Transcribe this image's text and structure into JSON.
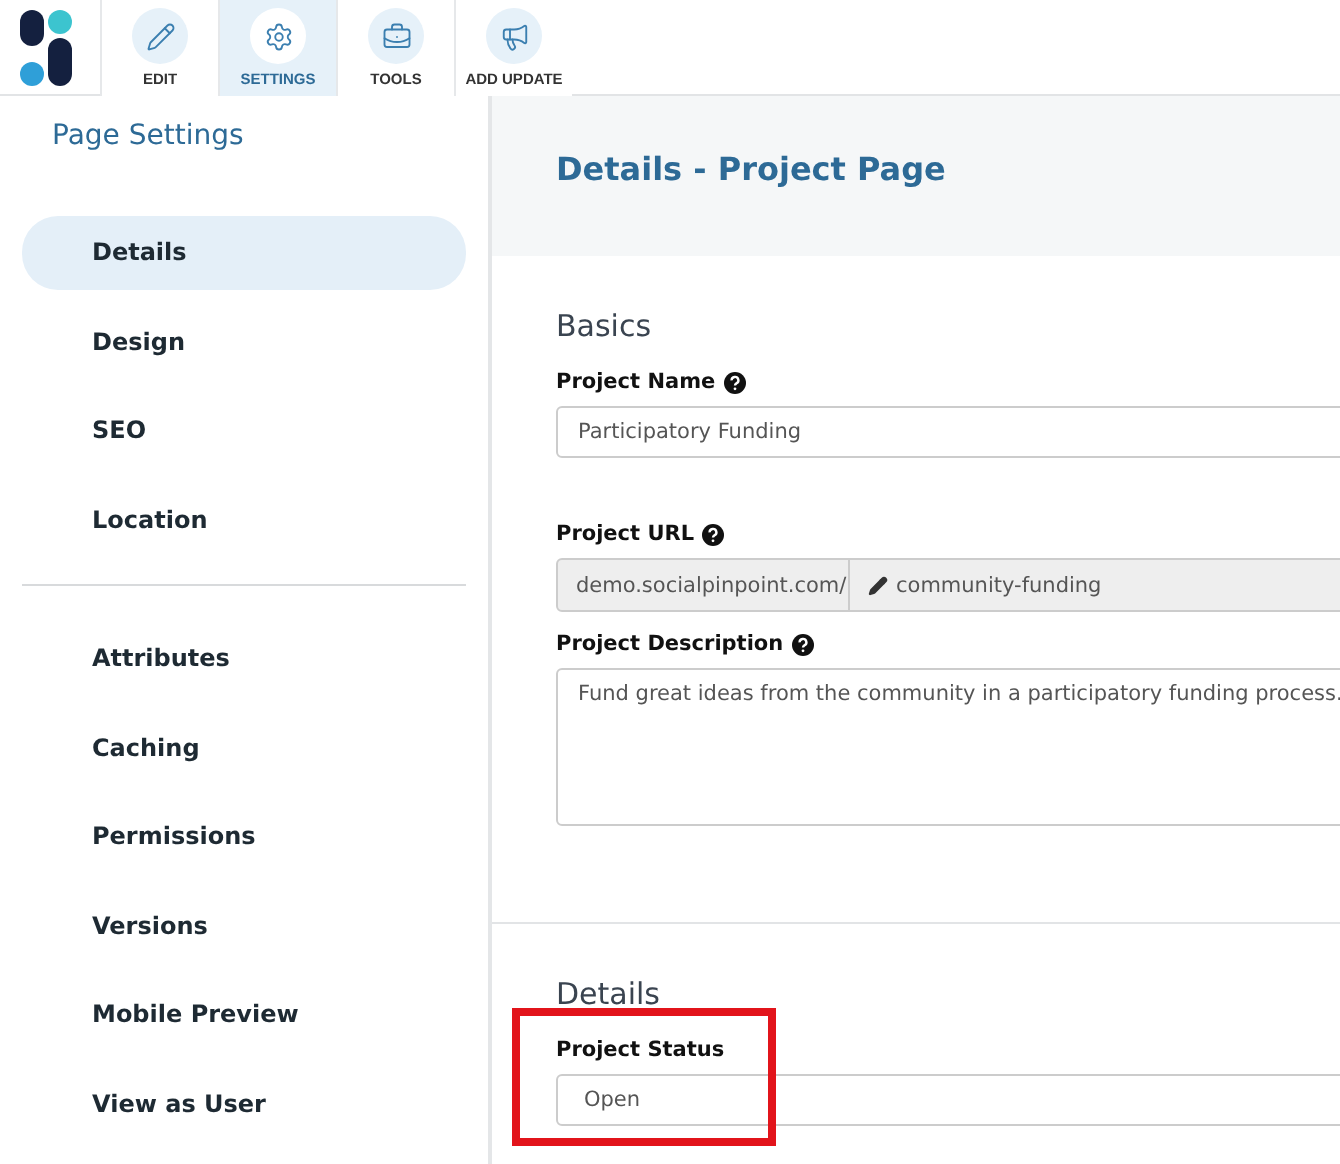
{
  "toolbar": {
    "tabs": [
      {
        "label": "EDIT",
        "selected": false
      },
      {
        "label": "SETTINGS",
        "selected": true
      },
      {
        "label": "TOOLS",
        "selected": false
      },
      {
        "label": "ADD UPDATE",
        "selected": false
      }
    ]
  },
  "sidebar": {
    "title": "Page Settings",
    "groups": [
      [
        {
          "label": "Details",
          "selected": true
        },
        {
          "label": "Design",
          "selected": false
        },
        {
          "label": "SEO",
          "selected": false
        },
        {
          "label": "Location",
          "selected": false
        }
      ],
      [
        {
          "label": "Attributes",
          "selected": false
        },
        {
          "label": "Caching",
          "selected": false
        },
        {
          "label": "Permissions",
          "selected": false
        },
        {
          "label": "Versions",
          "selected": false
        },
        {
          "label": "Mobile Preview",
          "selected": false
        },
        {
          "label": "View as User",
          "selected": false
        }
      ]
    ]
  },
  "page": {
    "title": "Details - Project Page",
    "sections": [
      {
        "title": "Basics",
        "fields": [
          {
            "kind": "text",
            "label": "Project Name",
            "help": true,
            "value": "Participatory Funding",
            "highlighted": false
          },
          {
            "kind": "url",
            "label": "Project URL",
            "help": true,
            "prefix": "demo.socialpinpoint.com/",
            "value": "community-funding",
            "highlighted": false
          },
          {
            "kind": "textarea",
            "label": "Project Description",
            "help": true,
            "value": "Fund great ideas from the community in a participatory funding process.",
            "highlighted": false
          }
        ]
      },
      {
        "title": "Details",
        "fields": [
          {
            "kind": "select",
            "label": "Project Status",
            "help": false,
            "value": "Open",
            "highlighted": true
          }
        ]
      }
    ]
  }
}
